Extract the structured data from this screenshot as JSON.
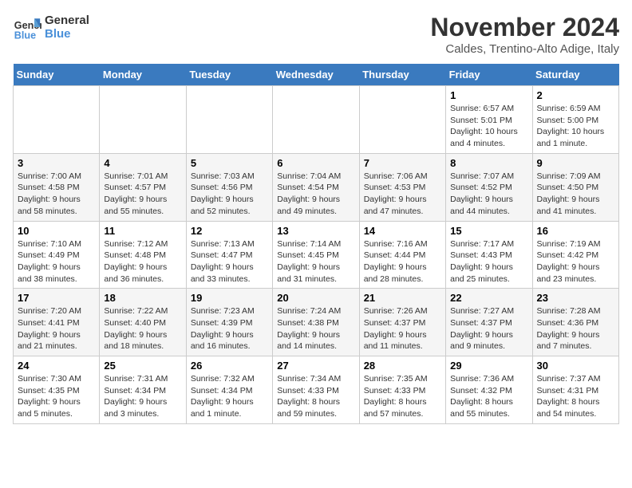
{
  "logo": {
    "line1": "General",
    "line2": "Blue"
  },
  "title": "November 2024",
  "location": "Caldes, Trentino-Alto Adige, Italy",
  "days_header": [
    "Sunday",
    "Monday",
    "Tuesday",
    "Wednesday",
    "Thursday",
    "Friday",
    "Saturday"
  ],
  "weeks": [
    [
      {
        "day": "",
        "info": ""
      },
      {
        "day": "",
        "info": ""
      },
      {
        "day": "",
        "info": ""
      },
      {
        "day": "",
        "info": ""
      },
      {
        "day": "",
        "info": ""
      },
      {
        "day": "1",
        "info": "Sunrise: 6:57 AM\nSunset: 5:01 PM\nDaylight: 10 hours and 4 minutes."
      },
      {
        "day": "2",
        "info": "Sunrise: 6:59 AM\nSunset: 5:00 PM\nDaylight: 10 hours and 1 minute."
      }
    ],
    [
      {
        "day": "3",
        "info": "Sunrise: 7:00 AM\nSunset: 4:58 PM\nDaylight: 9 hours and 58 minutes."
      },
      {
        "day": "4",
        "info": "Sunrise: 7:01 AM\nSunset: 4:57 PM\nDaylight: 9 hours and 55 minutes."
      },
      {
        "day": "5",
        "info": "Sunrise: 7:03 AM\nSunset: 4:56 PM\nDaylight: 9 hours and 52 minutes."
      },
      {
        "day": "6",
        "info": "Sunrise: 7:04 AM\nSunset: 4:54 PM\nDaylight: 9 hours and 49 minutes."
      },
      {
        "day": "7",
        "info": "Sunrise: 7:06 AM\nSunset: 4:53 PM\nDaylight: 9 hours and 47 minutes."
      },
      {
        "day": "8",
        "info": "Sunrise: 7:07 AM\nSunset: 4:52 PM\nDaylight: 9 hours and 44 minutes."
      },
      {
        "day": "9",
        "info": "Sunrise: 7:09 AM\nSunset: 4:50 PM\nDaylight: 9 hours and 41 minutes."
      }
    ],
    [
      {
        "day": "10",
        "info": "Sunrise: 7:10 AM\nSunset: 4:49 PM\nDaylight: 9 hours and 38 minutes."
      },
      {
        "day": "11",
        "info": "Sunrise: 7:12 AM\nSunset: 4:48 PM\nDaylight: 9 hours and 36 minutes."
      },
      {
        "day": "12",
        "info": "Sunrise: 7:13 AM\nSunset: 4:47 PM\nDaylight: 9 hours and 33 minutes."
      },
      {
        "day": "13",
        "info": "Sunrise: 7:14 AM\nSunset: 4:45 PM\nDaylight: 9 hours and 31 minutes."
      },
      {
        "day": "14",
        "info": "Sunrise: 7:16 AM\nSunset: 4:44 PM\nDaylight: 9 hours and 28 minutes."
      },
      {
        "day": "15",
        "info": "Sunrise: 7:17 AM\nSunset: 4:43 PM\nDaylight: 9 hours and 25 minutes."
      },
      {
        "day": "16",
        "info": "Sunrise: 7:19 AM\nSunset: 4:42 PM\nDaylight: 9 hours and 23 minutes."
      }
    ],
    [
      {
        "day": "17",
        "info": "Sunrise: 7:20 AM\nSunset: 4:41 PM\nDaylight: 9 hours and 21 minutes."
      },
      {
        "day": "18",
        "info": "Sunrise: 7:22 AM\nSunset: 4:40 PM\nDaylight: 9 hours and 18 minutes."
      },
      {
        "day": "19",
        "info": "Sunrise: 7:23 AM\nSunset: 4:39 PM\nDaylight: 9 hours and 16 minutes."
      },
      {
        "day": "20",
        "info": "Sunrise: 7:24 AM\nSunset: 4:38 PM\nDaylight: 9 hours and 14 minutes."
      },
      {
        "day": "21",
        "info": "Sunrise: 7:26 AM\nSunset: 4:37 PM\nDaylight: 9 hours and 11 minutes."
      },
      {
        "day": "22",
        "info": "Sunrise: 7:27 AM\nSunset: 4:37 PM\nDaylight: 9 hours and 9 minutes."
      },
      {
        "day": "23",
        "info": "Sunrise: 7:28 AM\nSunset: 4:36 PM\nDaylight: 9 hours and 7 minutes."
      }
    ],
    [
      {
        "day": "24",
        "info": "Sunrise: 7:30 AM\nSunset: 4:35 PM\nDaylight: 9 hours and 5 minutes."
      },
      {
        "day": "25",
        "info": "Sunrise: 7:31 AM\nSunset: 4:34 PM\nDaylight: 9 hours and 3 minutes."
      },
      {
        "day": "26",
        "info": "Sunrise: 7:32 AM\nSunset: 4:34 PM\nDaylight: 9 hours and 1 minute."
      },
      {
        "day": "27",
        "info": "Sunrise: 7:34 AM\nSunset: 4:33 PM\nDaylight: 8 hours and 59 minutes."
      },
      {
        "day": "28",
        "info": "Sunrise: 7:35 AM\nSunset: 4:33 PM\nDaylight: 8 hours and 57 minutes."
      },
      {
        "day": "29",
        "info": "Sunrise: 7:36 AM\nSunset: 4:32 PM\nDaylight: 8 hours and 55 minutes."
      },
      {
        "day": "30",
        "info": "Sunrise: 7:37 AM\nSunset: 4:31 PM\nDaylight: 8 hours and 54 minutes."
      }
    ]
  ]
}
